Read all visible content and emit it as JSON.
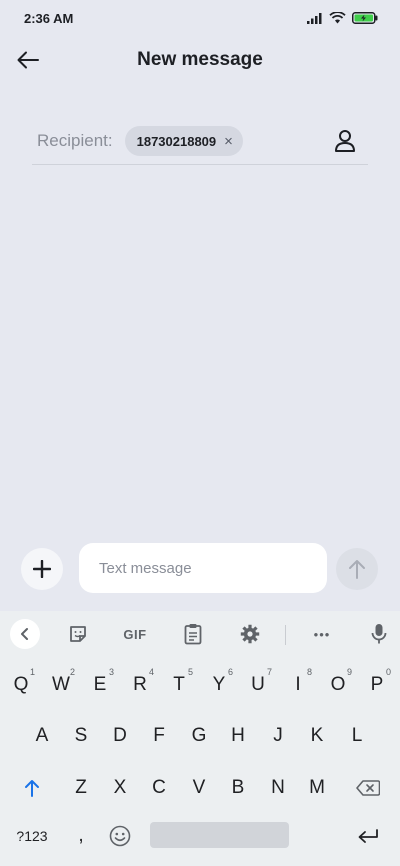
{
  "status_bar": {
    "time": "2:36 AM"
  },
  "header": {
    "title": "New message"
  },
  "recipient": {
    "label": "Recipient:",
    "chip_value": "18730218809",
    "chip_close": "×"
  },
  "compose": {
    "placeholder": "Text message"
  },
  "keyboard": {
    "toolbar": {
      "gif_label": "GIF",
      "more_label": "•••"
    },
    "row1": [
      {
        "key": "Q",
        "hint": "1"
      },
      {
        "key": "W",
        "hint": "2"
      },
      {
        "key": "E",
        "hint": "3"
      },
      {
        "key": "R",
        "hint": "4"
      },
      {
        "key": "T",
        "hint": "5"
      },
      {
        "key": "Y",
        "hint": "6"
      },
      {
        "key": "U",
        "hint": "7"
      },
      {
        "key": "I",
        "hint": "8"
      },
      {
        "key": "O",
        "hint": "9"
      },
      {
        "key": "P",
        "hint": "0"
      }
    ],
    "row2": [
      "A",
      "S",
      "D",
      "F",
      "G",
      "H",
      "J",
      "K",
      "L"
    ],
    "row3": [
      "Z",
      "X",
      "C",
      "V",
      "B",
      "N",
      "M"
    ],
    "bottom": {
      "symbols_label": "?123",
      "comma_label": ","
    }
  },
  "colors": {
    "background": "#e6e8f0",
    "accent": "#1a73e8",
    "keyboard_bg": "#eceff1"
  },
  "icons": [
    "back-arrow-icon",
    "contact-icon",
    "plus-icon",
    "send-arrow-icon",
    "wifi-icon",
    "signal-icon",
    "battery-icon",
    "sticker-icon",
    "clipboard-icon",
    "gear-icon",
    "mic-icon",
    "shift-icon",
    "backspace-icon",
    "emoji-icon",
    "enter-icon"
  ]
}
